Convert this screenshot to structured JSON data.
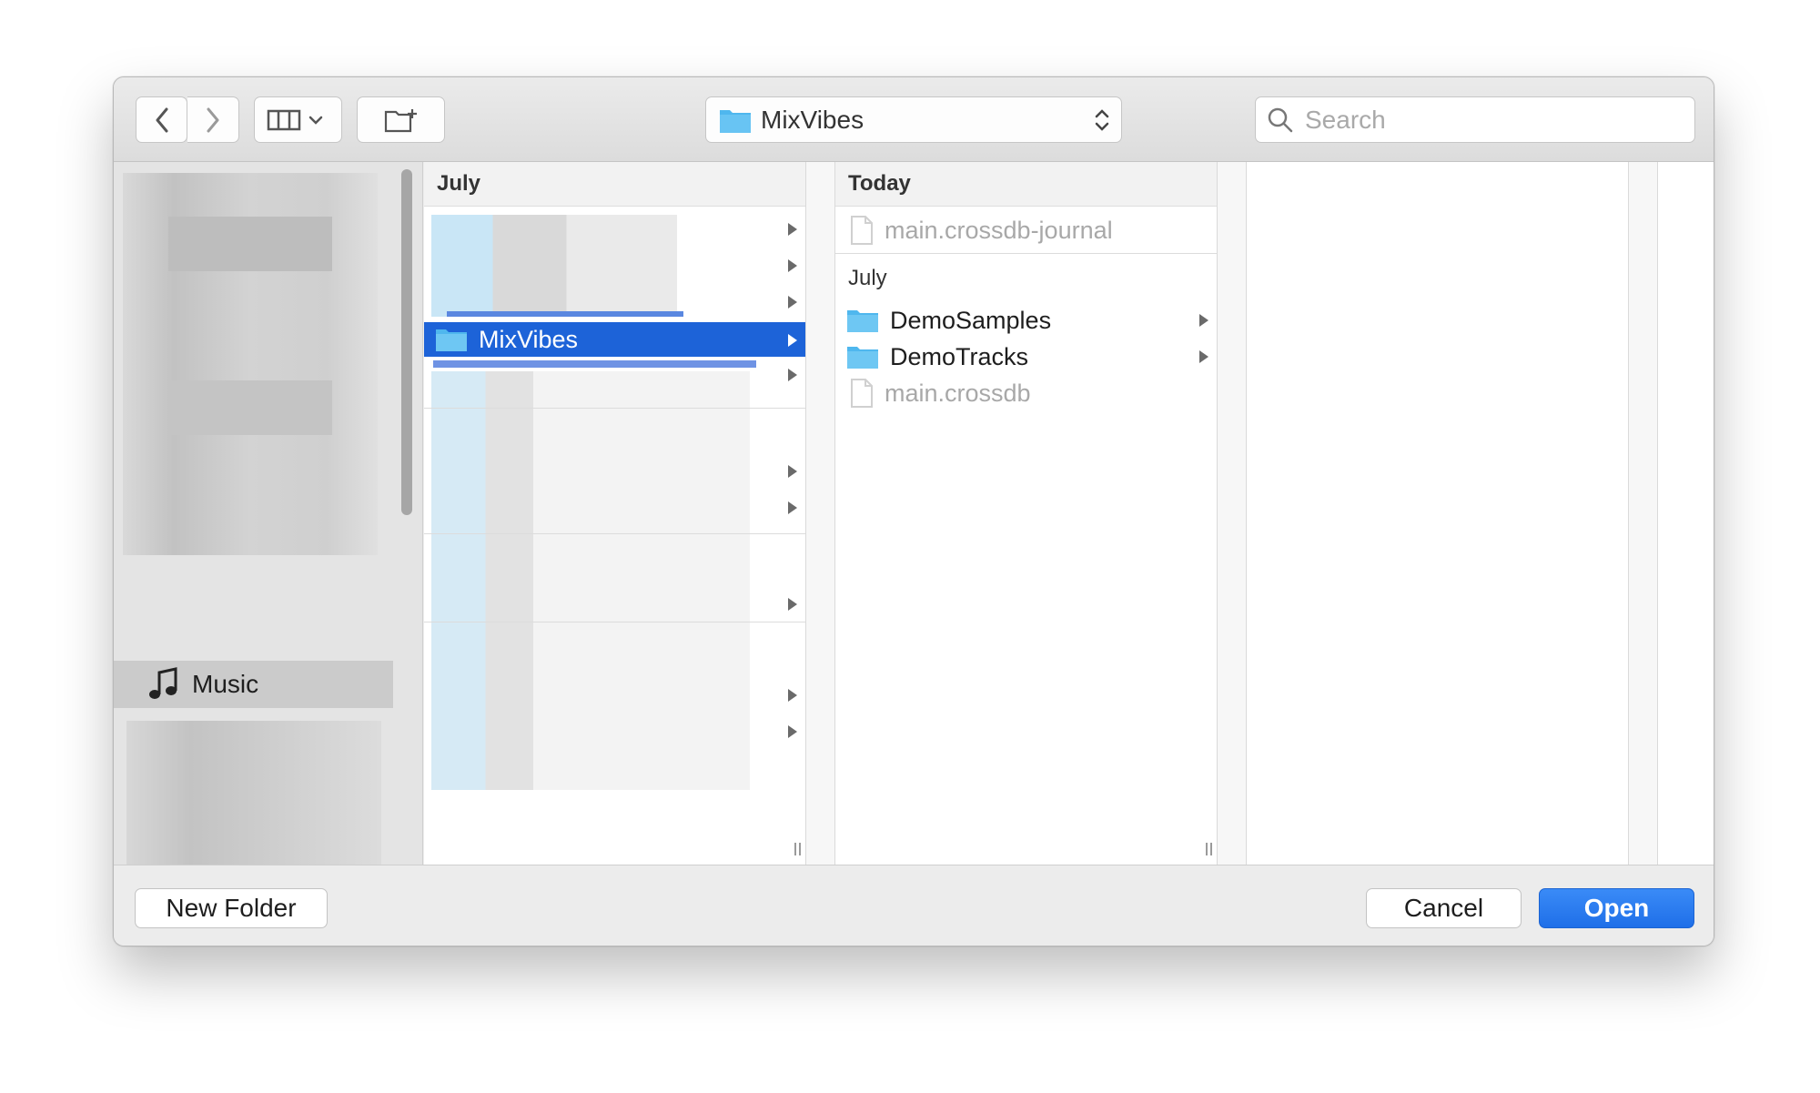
{
  "toolbar": {
    "back_icon": "chevron-left-icon",
    "forward_icon": "chevron-right-icon",
    "view_icon": "column-view-icon",
    "new_folder_icon": "folder-plus-icon",
    "path_label": "MixVibes",
    "search_placeholder": "Search"
  },
  "sidebar": {
    "selected_item": {
      "label": "Music",
      "icon": "music-note-icon"
    }
  },
  "columns": [
    {
      "header": "July",
      "selected_row": {
        "label": "MixVibes",
        "icon": "folder-icon"
      }
    },
    {
      "header": "Today",
      "today_items": [
        {
          "label": "main.crossdb-journal",
          "icon": "file-icon",
          "dim": true
        }
      ],
      "group_label": "July",
      "july_items": [
        {
          "label": "DemoSamples",
          "icon": "folder-icon",
          "has_children": true
        },
        {
          "label": "DemoTracks",
          "icon": "folder-icon",
          "has_children": true
        },
        {
          "label": "main.crossdb",
          "icon": "file-icon",
          "dim": true
        }
      ]
    }
  ],
  "footer": {
    "new_folder_label": "New Folder",
    "cancel_label": "Cancel",
    "open_label": "Open"
  },
  "colors": {
    "accent": "#1d63d8",
    "primary_button": "#2a7cf0",
    "folder": "#4fb7ee"
  }
}
